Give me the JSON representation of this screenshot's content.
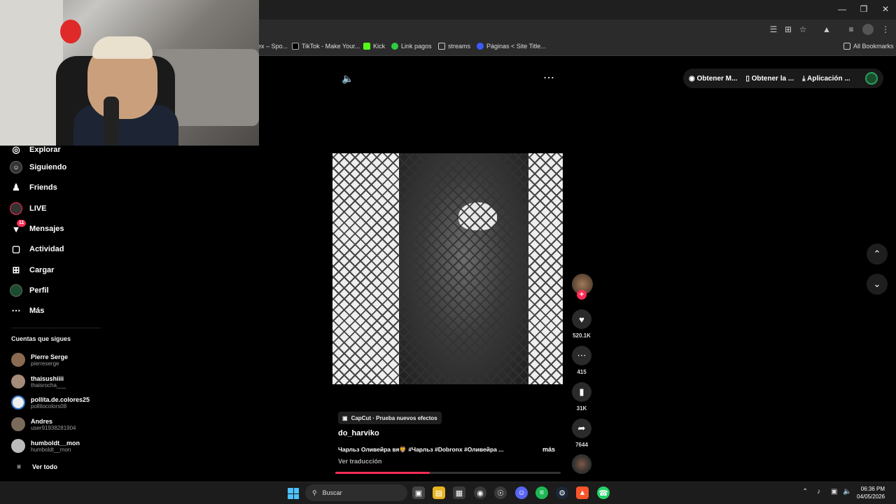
{
  "browser": {
    "bookmarks": [
      {
        "label": "ex – Spo..."
      },
      {
        "label": "TikTok - Make Your..."
      },
      {
        "label": "Kick"
      },
      {
        "label": "Link pagos"
      },
      {
        "label": "streams"
      },
      {
        "label": "Páginas < Site Title..."
      }
    ],
    "all_bookmarks": "All Bookmarks"
  },
  "sidebar": {
    "items": [
      {
        "label": "Explorar",
        "icon": "compass-icon"
      },
      {
        "label": "Siguiendo",
        "icon": "avatar-icon"
      },
      {
        "label": "Friends",
        "icon": "friends-icon"
      },
      {
        "label": "LIVE",
        "icon": "live-icon"
      },
      {
        "label": "Mensajes",
        "icon": "messages-icon",
        "badge": "11"
      },
      {
        "label": "Actividad",
        "icon": "activity-icon"
      },
      {
        "label": "Cargar",
        "icon": "upload-icon"
      },
      {
        "label": "Perfil",
        "icon": "profile-icon"
      },
      {
        "label": "Más",
        "icon": "more-icon"
      }
    ],
    "following_title": "Cuentas que sigues",
    "following": [
      {
        "name": "Pierre Serge",
        "user": "pierreserge"
      },
      {
        "name": "thaisushiiii",
        "user": "thaisrocha___"
      },
      {
        "name": "pollita.de.colores25",
        "user": "pollitocolors08"
      },
      {
        "name": "Andres",
        "user": "user91938281904"
      },
      {
        "name": "humboldt__mon",
        "user": "humboldt__mon"
      }
    ],
    "see_all": "Ver todo"
  },
  "topbar": {
    "get_m": "Obtener M...",
    "get_app": "Obtener la ...",
    "app": "Aplicación ..."
  },
  "video": {
    "effect": "CapCut · Prueba nuevos efectos",
    "author": "do_harviko",
    "caption": "Чарльз Оливейра вя🦁 #Чарльз #Dobronx #Оливейра ...",
    "more": "más",
    "translate": "Ver traducción",
    "progress": 0.42,
    "likes": "520.1K",
    "comments": "415",
    "saves": "31K",
    "shares": "7644"
  },
  "taskbar": {
    "search_placeholder": "Buscar",
    "time": "06:36 PM",
    "date": "04/05/2026"
  },
  "colors": {
    "accent": "#fe2c55",
    "windows_blue": "#4cc2ff"
  }
}
